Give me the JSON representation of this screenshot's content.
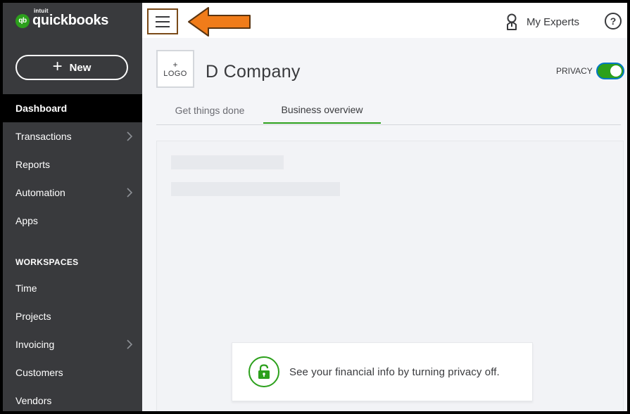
{
  "brand": {
    "intuit": "intuit",
    "name": "quickbooks",
    "mark": "qb"
  },
  "sidebar": {
    "new_button": "New",
    "items": [
      {
        "label": "Dashboard",
        "active": true,
        "has_chevron": false
      },
      {
        "label": "Transactions",
        "active": false,
        "has_chevron": true
      },
      {
        "label": "Reports",
        "active": false,
        "has_chevron": false
      },
      {
        "label": "Automation",
        "active": false,
        "has_chevron": true
      },
      {
        "label": "Apps",
        "active": false,
        "has_chevron": false
      }
    ],
    "section_label": "WORKSPACES",
    "workspace_items": [
      {
        "label": "Time",
        "has_chevron": false
      },
      {
        "label": "Projects",
        "has_chevron": false
      },
      {
        "label": "Invoicing",
        "has_chevron": true
      },
      {
        "label": "Customers",
        "has_chevron": false
      },
      {
        "label": "Vendors",
        "has_chevron": false
      }
    ]
  },
  "topbar": {
    "menu_icon": "hamburger-icon",
    "arrow_icon": "orange-arrow-icon",
    "my_experts": "My Experts",
    "help_label": "?"
  },
  "main": {
    "logo_plus": "+",
    "logo_label": "LOGO",
    "company_name": "D Company",
    "privacy_label": "PRIVACY",
    "privacy_on": true,
    "tabs": [
      {
        "label": "Get things done",
        "active": false
      },
      {
        "label": "Business overview",
        "active": true
      }
    ],
    "notice_text": "See your financial info by turning privacy off."
  },
  "colors": {
    "sidebar_bg": "#393a3d",
    "accent_green": "#2ca01c",
    "arrow_orange": "#f07c1a",
    "highlight_border": "#7a4a18"
  }
}
